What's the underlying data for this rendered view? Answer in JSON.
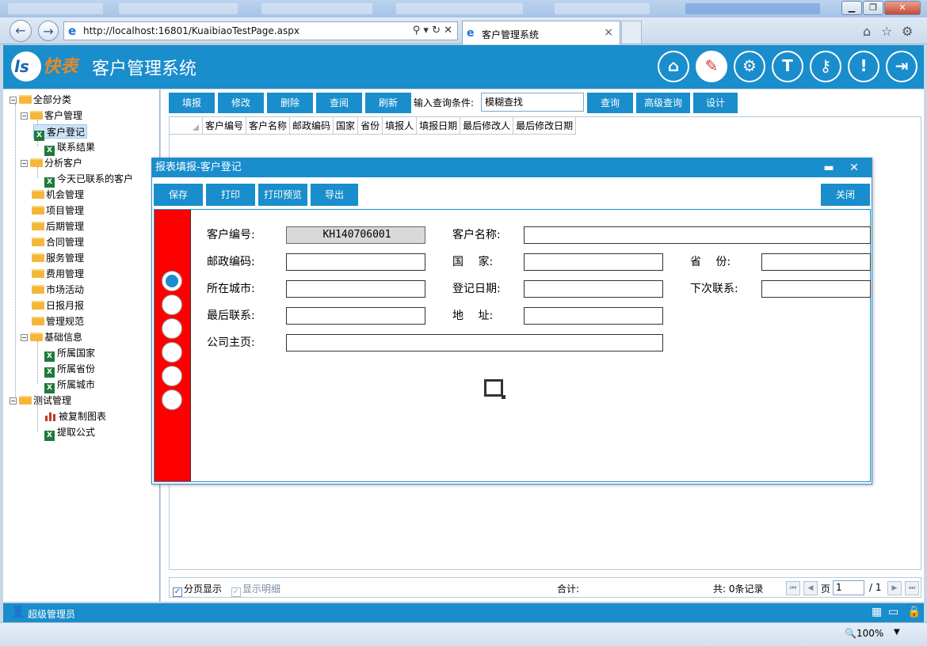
{
  "browser": {
    "url": "http://localhost:16801/KuaibiaoTestPage.aspx",
    "tab_title": "客户管理系统",
    "tab_close": "×",
    "zoom": "100%"
  },
  "header": {
    "brand": "快表",
    "title": "客户管理系统",
    "icons": [
      "home-icon",
      "edit-report-icon",
      "gear-icon",
      "shirt-icon",
      "key-icon",
      "alert-icon",
      "exit-icon"
    ]
  },
  "tree": {
    "root": "全部分类",
    "groups": [
      {
        "label": "客户管理",
        "children": [
          "客户登记",
          "联系结果"
        ]
      },
      {
        "label": "分析客户",
        "children": [
          "今天已联系的客户"
        ]
      },
      {
        "label": "机会管理",
        "children": []
      },
      {
        "label": "项目管理",
        "children": []
      },
      {
        "label": "后期管理",
        "children": []
      },
      {
        "label": "合同管理",
        "children": []
      },
      {
        "label": "服务管理",
        "children": []
      },
      {
        "label": "费用管理",
        "children": []
      },
      {
        "label": "市场活动",
        "children": []
      },
      {
        "label": "日报月报",
        "children": []
      },
      {
        "label": "管理规范",
        "children": []
      },
      {
        "label": "基础信息",
        "children": [
          "所属国家",
          "所属省份",
          "所属城市"
        ]
      },
      {
        "label": "测试管理",
        "children": [
          "被复制图表",
          "提取公式"
        ]
      }
    ]
  },
  "toolbar": {
    "fill": "填报",
    "modify": "修改",
    "delete": "删除",
    "view": "查阅",
    "refresh": "刷新",
    "query_label": "输入查询条件:",
    "query_value": "模糊查找",
    "search": "查询",
    "advanced": "高级查询",
    "design": "设计"
  },
  "grid": {
    "columns": [
      "客户编号",
      "客户名称",
      "邮政编码",
      "国家",
      "省份",
      "填报人",
      "填报日期",
      "最后修改人",
      "最后修改日期"
    ]
  },
  "footer": {
    "paging": "分页显示",
    "paging_check": "✓",
    "detail": "显示明细",
    "detail_check": "✓",
    "total_label": "合计:",
    "records": "共: 0条记录",
    "page_label": "页",
    "page_value": "1",
    "page_total": "/ 1"
  },
  "dialog": {
    "title": "报表填报-客户登记",
    "minimize": "▬",
    "close": "✕",
    "buttons": {
      "save": "保存",
      "print": "打印",
      "preview": "打印预览",
      "export": "导出",
      "close": "关闭"
    },
    "fields": {
      "customer_no_label": "客户编号:",
      "customer_no_value": "KH140706001",
      "customer_name_label": "客户名称:",
      "postal_label": "邮政编码:",
      "country_label": "国　 家:",
      "province_label": "省　 份:",
      "city_label": "所在城市:",
      "reg_date_label": "登记日期:",
      "next_contact_label": "下次联系:",
      "last_contact_label": "最后联系:",
      "address_label": "地　 址:",
      "homepage_label": "公司主页:"
    }
  },
  "status": {
    "user": "超级管理员"
  }
}
